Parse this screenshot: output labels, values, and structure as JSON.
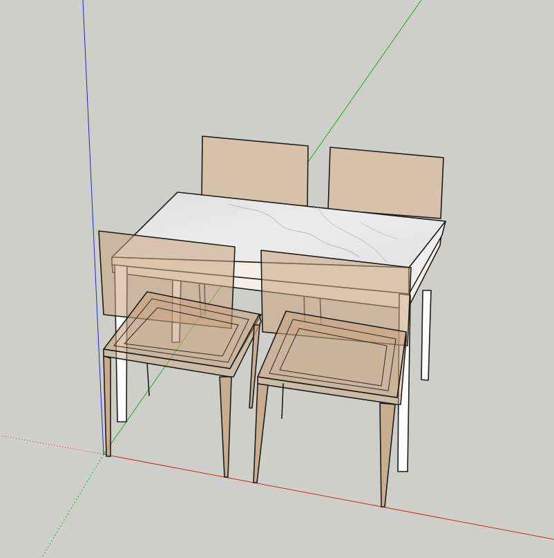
{
  "viewport": {
    "background_color": "#cfcfc9"
  },
  "axes": {
    "x_axis_color": "#cc2222",
    "y_axis_color": "#22aa22",
    "z_axis_color": "#2222cc"
  },
  "model": {
    "objects": [
      {
        "name": "dining-table",
        "top_material": "white marble",
        "top_color": "#e4e4e4",
        "leg_color": "#ffffff"
      },
      {
        "name": "chair-back-left",
        "color": "#d8c1aa"
      },
      {
        "name": "chair-back-right",
        "color": "#d8c1aa"
      },
      {
        "name": "chair-front-left",
        "color": "#c8a27e",
        "transparent": true
      },
      {
        "name": "chair-front-right",
        "color": "#c8a27e",
        "transparent": true
      }
    ]
  }
}
